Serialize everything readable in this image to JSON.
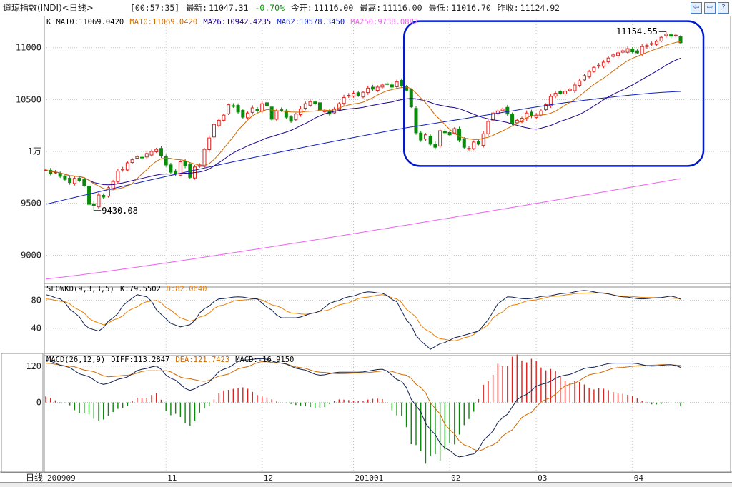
{
  "window": {
    "title": "道琼指数(INDI)<日线>",
    "quote": {
      "time": "[00:57:35]",
      "latest_label": "最新:",
      "latest": "11047.31",
      "change": "-0.70%",
      "open_label": "今开:",
      "open": "11116.00",
      "high_label": "最高:",
      "high": "11116.00",
      "low_label": "最低:",
      "low": "11016.70",
      "prev_close_label": "昨收:",
      "prev_close": "11124.92"
    },
    "buttons": [
      "⇦",
      "⇨",
      "?"
    ]
  },
  "colors": {
    "up": "#e0201c",
    "down": "#0a8a0a",
    "ma10": "#d06a00",
    "ma26": "#200090",
    "ma62": "#1020c0",
    "ma250": "#f060f0",
    "k_line": "#102050",
    "d_line": "#f08000",
    "grid": "#c4c4c4",
    "highlight_box": "#0018c8"
  },
  "chart_data": [
    {
      "type": "candlestick",
      "panel": "main",
      "legend": [
        {
          "text": "K",
          "color": "#000000"
        },
        {
          "text": "MA10:11069.0420",
          "color": "#000000"
        },
        {
          "text": "MA10:11069.0420",
          "color": "#d06a00"
        },
        {
          "text": "MA26:10942.4235",
          "color": "#200090"
        },
        {
          "text": "MA62:10578.3450",
          "color": "#1020c0"
        },
        {
          "text": "MA250:9738.0882",
          "color": "#f060f0"
        }
      ],
      "yticks": [
        {
          "value": 9000,
          "label": "9000"
        },
        {
          "value": 9500,
          "label": "9500"
        },
        {
          "value": 10000,
          "label": "1万"
        },
        {
          "value": 10500,
          "label": "10500"
        },
        {
          "value": 11000,
          "label": "11000"
        }
      ],
      "ylim": [
        8720,
        11280
      ],
      "close": [
        9820,
        9790,
        9800,
        9760,
        9730,
        9700,
        9740,
        9720,
        9670,
        9490,
        9480,
        9580,
        9560,
        9650,
        9710,
        9810,
        9830,
        9890,
        9920,
        9950,
        9940,
        9980,
        10000,
        10020,
        9960,
        9870,
        9800,
        9780,
        9900,
        9860,
        9750,
        9850,
        9870,
        10020,
        10130,
        10260,
        10300,
        10350,
        10450,
        10440,
        10380,
        10330,
        10370,
        10420,
        10390,
        10460,
        10440,
        10310,
        10390,
        10400,
        10330,
        10290,
        10360,
        10410,
        10460,
        10480,
        10460,
        10400,
        10390,
        10360,
        10410,
        10460,
        10520,
        10540,
        10560,
        10540,
        10570,
        10610,
        10600,
        10620,
        10640,
        10650,
        10620,
        10670,
        10630,
        10590,
        10430,
        10180,
        10110,
        10160,
        10070,
        10040,
        10200,
        10180,
        10160,
        10220,
        10110,
        10040,
        10030,
        10090,
        10070,
        10170,
        10290,
        10370,
        10390,
        10410,
        10360,
        10270,
        10300,
        10320,
        10370,
        10340,
        10350,
        10390,
        10450,
        10530,
        10560,
        10560,
        10580,
        10600,
        10640,
        10680,
        10730,
        10770,
        10810,
        10830,
        10860,
        10900,
        10930,
        10950,
        10970,
        10990,
        10960,
        10950,
        11010,
        11020,
        11040,
        11060,
        11100,
        11130,
        11110,
        11120,
        11047
      ],
      "annotations": [
        {
          "text": "9430.08",
          "value": 9430.08,
          "index": 10
        },
        {
          "text": "11154.55",
          "value": 11154.55,
          "index": 129
        }
      ],
      "ma_lines": [
        {
          "name": "MA10",
          "period": 10,
          "color": "#d06a00"
        },
        {
          "name": "MA26",
          "period": 26,
          "color": "#200090"
        },
        {
          "name": "MA62",
          "start": 9490,
          "end": 10578
        },
        {
          "name": "MA250",
          "start": 8770,
          "end": 9738
        }
      ],
      "xticks": [
        {
          "label": "200909",
          "index": 0
        },
        {
          "label": "11",
          "index": 25
        },
        {
          "label": "12",
          "index": 45
        },
        {
          "label": "201001",
          "index": 64
        },
        {
          "label": "02",
          "index": 84
        },
        {
          "label": "03",
          "index": 102
        },
        {
          "label": "04",
          "index": 122
        }
      ],
      "x_axis_label": "日线"
    },
    {
      "type": "line",
      "panel": "slowkd",
      "title": "SLOWKD(9,3,3,5)",
      "legend": [
        {
          "text": "SLOWKD(9,3,3,5)",
          "color": "#000000"
        },
        {
          "text": "K:79.5502",
          "color": "#000000"
        },
        {
          "text": "D:82.0640",
          "color": "#f08000"
        }
      ],
      "yticks": [
        {
          "value": 40,
          "label": "40"
        },
        {
          "value": 80,
          "label": "80"
        }
      ],
      "ylim": [
        5,
        100
      ],
      "series": [
        {
          "name": "K",
          "keyframes": [
            [
              0,
              88
            ],
            [
              3,
              82
            ],
            [
              6,
              62
            ],
            [
              9,
              40
            ],
            [
              11,
              36
            ],
            [
              14,
              55
            ],
            [
              17,
              78
            ],
            [
              19,
              88
            ],
            [
              21,
              85
            ],
            [
              24,
              60
            ],
            [
              26,
              47
            ],
            [
              28,
              42
            ],
            [
              30,
              45
            ],
            [
              33,
              68
            ],
            [
              36,
              82
            ],
            [
              40,
              85
            ],
            [
              44,
              82
            ],
            [
              46,
              70
            ],
            [
              49,
              55
            ],
            [
              52,
              55
            ],
            [
              56,
              62
            ],
            [
              60,
              78
            ],
            [
              63,
              85
            ],
            [
              67,
              92
            ],
            [
              70,
              90
            ],
            [
              73,
              78
            ],
            [
              75,
              52
            ],
            [
              78,
              22
            ],
            [
              80,
              10
            ],
            [
              82,
              18
            ],
            [
              86,
              28
            ],
            [
              88,
              32
            ],
            [
              90,
              36
            ],
            [
              92,
              52
            ],
            [
              94,
              75
            ],
            [
              96,
              85
            ],
            [
              100,
              82
            ],
            [
              104,
              86
            ],
            [
              108,
              90
            ],
            [
              112,
              94
            ],
            [
              116,
              90
            ],
            [
              120,
              85
            ],
            [
              124,
              82
            ],
            [
              128,
              84
            ],
            [
              130,
              86
            ],
            [
              133,
              80
            ]
          ]
        },
        {
          "name": "D",
          "keyframes": [
            [
              0,
              82
            ],
            [
              4,
              78
            ],
            [
              7,
              66
            ],
            [
              10,
              50
            ],
            [
              12,
              45
            ],
            [
              15,
              54
            ],
            [
              18,
              68
            ],
            [
              21,
              78
            ],
            [
              23,
              80
            ],
            [
              26,
              66
            ],
            [
              28,
              55
            ],
            [
              30,
              50
            ],
            [
              33,
              58
            ],
            [
              36,
              72
            ],
            [
              40,
              80
            ],
            [
              44,
              82
            ],
            [
              48,
              72
            ],
            [
              51,
              62
            ],
            [
              54,
              60
            ],
            [
              58,
              65
            ],
            [
              62,
              75
            ],
            [
              66,
              84
            ],
            [
              70,
              88
            ],
            [
              73,
              82
            ],
            [
              76,
              62
            ],
            [
              79,
              38
            ],
            [
              82,
              25
            ],
            [
              85,
              22
            ],
            [
              88,
              28
            ],
            [
              91,
              40
            ],
            [
              94,
              60
            ],
            [
              97,
              73
            ],
            [
              101,
              80
            ],
            [
              106,
              86
            ],
            [
              111,
              90
            ],
            [
              115,
              91
            ],
            [
              120,
              86
            ],
            [
              125,
              84
            ],
            [
              130,
              83
            ],
            [
              133,
              82
            ]
          ]
        }
      ],
      "latest": {
        "K": 79.5502,
        "D": 82.064
      }
    },
    {
      "type": "bar",
      "panel": "macd",
      "title": "MACD(26,12,9)",
      "legend": [
        {
          "text": "MACD(26,12,9)",
          "color": "#000000"
        },
        {
          "text": "DIFF:113.2847",
          "color": "#000000"
        },
        {
          "text": "DEA:121.7423",
          "color": "#d06a00"
        },
        {
          "text": "MACD:-16.9150",
          "color": "#000000"
        }
      ],
      "yticks": [
        {
          "value": 0,
          "label": "0"
        },
        {
          "value": 120,
          "label": "120"
        }
      ],
      "ylim": [
        -225,
        155
      ],
      "series": [
        {
          "name": "DIFF",
          "keyframes": [
            [
              0,
              140
            ],
            [
              4,
              120
            ],
            [
              8,
              90
            ],
            [
              12,
              60
            ],
            [
              16,
              80
            ],
            [
              20,
              110
            ],
            [
              23,
              120
            ],
            [
              26,
              80
            ],
            [
              30,
              40
            ],
            [
              33,
              60
            ],
            [
              37,
              110
            ],
            [
              41,
              140
            ],
            [
              45,
              145
            ],
            [
              49,
              130
            ],
            [
              53,
              110
            ],
            [
              57,
              90
            ],
            [
              61,
              100
            ],
            [
              65,
              100
            ],
            [
              70,
              110
            ],
            [
              74,
              70
            ],
            [
              77,
              -10
            ],
            [
              80,
              -90
            ],
            [
              83,
              -150
            ],
            [
              86,
              -180
            ],
            [
              89,
              -170
            ],
            [
              92,
              -110
            ],
            [
              95,
              -50
            ],
            [
              99,
              20
            ],
            [
              103,
              60
            ],
            [
              108,
              90
            ],
            [
              113,
              115
            ],
            [
              118,
              130
            ],
            [
              122,
              130
            ],
            [
              126,
              120
            ],
            [
              130,
              125
            ],
            [
              133,
              113
            ]
          ]
        },
        {
          "name": "DEA",
          "keyframes": [
            [
              0,
              130
            ],
            [
              5,
              120
            ],
            [
              9,
              105
            ],
            [
              13,
              85
            ],
            [
              17,
              90
            ],
            [
              21,
              105
            ],
            [
              25,
              105
            ],
            [
              29,
              80
            ],
            [
              33,
              70
            ],
            [
              37,
              90
            ],
            [
              41,
              115
            ],
            [
              45,
              135
            ],
            [
              49,
              130
            ],
            [
              53,
              115
            ],
            [
              57,
              100
            ],
            [
              61,
              95
            ],
            [
              66,
              98
            ],
            [
              71,
              105
            ],
            [
              75,
              90
            ],
            [
              78,
              50
            ],
            [
              81,
              -20
            ],
            [
              84,
              -90
            ],
            [
              87,
              -140
            ],
            [
              90,
              -160
            ],
            [
              93,
              -140
            ],
            [
              96,
              -100
            ],
            [
              100,
              -40
            ],
            [
              104,
              10
            ],
            [
              109,
              60
            ],
            [
              114,
              95
            ],
            [
              119,
              115
            ],
            [
              124,
              122
            ],
            [
              129,
              125
            ],
            [
              133,
              121.7
            ]
          ]
        }
      ],
      "latest": {
        "DIFF": 113.2847,
        "DEA": 121.7423,
        "MACD": -16.915
      }
    }
  ]
}
